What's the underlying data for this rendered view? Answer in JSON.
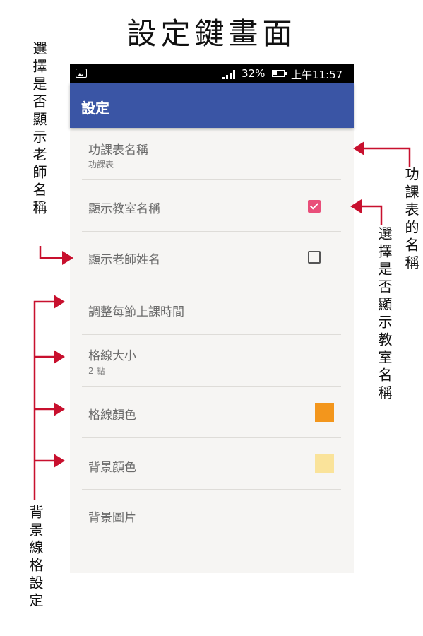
{
  "title": "設定鍵畫面",
  "status_bar": {
    "signal_strength": "32%",
    "time": "上午11:57"
  },
  "app_bar": {
    "title": "設定"
  },
  "settings": [
    {
      "label": "功課表名稱",
      "subtitle": "功課表"
    },
    {
      "label": "顯示教室名稱",
      "control": "checkbox",
      "checked": true
    },
    {
      "label": "顯示老師姓名",
      "control": "checkbox",
      "checked": false
    },
    {
      "label": "調整每節上課時間"
    },
    {
      "label": "格線大小",
      "subtitle": "2 點"
    },
    {
      "label": "格線顏色",
      "control": "color",
      "color": "#f3961c"
    },
    {
      "label": "背景顏色",
      "control": "color",
      "color": "#fae39a"
    },
    {
      "label": "背景圖片"
    }
  ],
  "annotations": {
    "left_top": "選擇是否顯示老師名稱",
    "right_top": "功課表的名稱",
    "right_middle": "選擇是否顯示教室名稱",
    "left_bottom": "背景線格設定"
  },
  "colors": {
    "accent": "#3a55a5",
    "checkbox": "#e94f7a",
    "arrow": "#c8102e"
  }
}
